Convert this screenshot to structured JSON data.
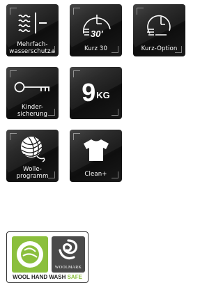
{
  "tiles": {
    "mehrfach_wasserschutz": {
      "label": "Mehrfach-\nwasserschutz+",
      "icon": "water-protection-icon"
    },
    "kurz30": {
      "label": "Kurz 30",
      "icon_text": "30'",
      "icon": "quick-wash-30-icon"
    },
    "kurz_option": {
      "label": "Kurz-Option",
      "icon": "quick-option-icon"
    },
    "kindersicherung": {
      "label": "Kinder-\nsicherung",
      "icon": "key-icon"
    },
    "capacity": {
      "number": "9",
      "unit": "KG"
    },
    "wolle": {
      "label": "Wolle-\nprogramm",
      "icon": "wool-ball-icon"
    },
    "clean_plus": {
      "label": "Clean+",
      "icon": "shirt-icon"
    }
  },
  "wool_badge": {
    "text_main": "WOOL HAND WASH ",
    "text_highlight": "SAFE",
    "logo_text": "WOOLMARK",
    "colors": {
      "green": "#8bbf3d",
      "dark": "#4a4a4a"
    }
  }
}
